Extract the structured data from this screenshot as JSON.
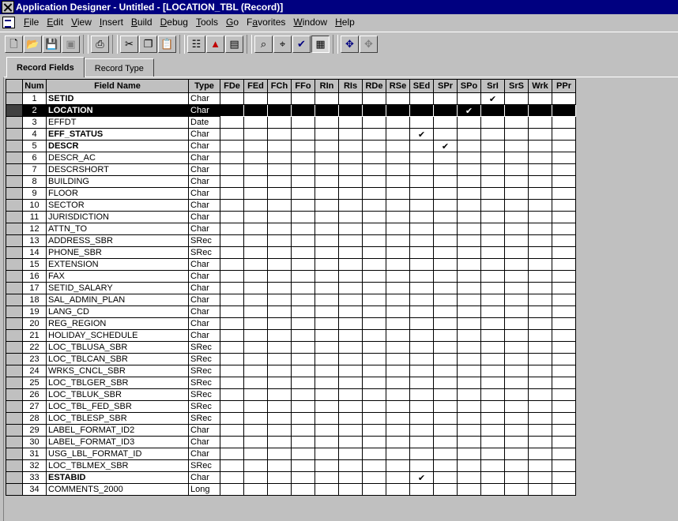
{
  "window": {
    "title": "Application Designer - Untitled - [LOCATION_TBL (Record)]"
  },
  "menu": [
    {
      "label": "File",
      "mnemonic": "F",
      "rest": "ile"
    },
    {
      "label": "Edit",
      "mnemonic": "E",
      "rest": "dit"
    },
    {
      "label": "View",
      "mnemonic": "V",
      "rest": "iew"
    },
    {
      "label": "Insert",
      "mnemonic": "I",
      "rest": "nsert"
    },
    {
      "label": "Build",
      "mnemonic": "B",
      "rest": "uild"
    },
    {
      "label": "Debug",
      "mnemonic": "D",
      "rest": "ebug"
    },
    {
      "label": "Tools",
      "mnemonic": "T",
      "rest": "ools"
    },
    {
      "label": "Go",
      "mnemonic": "G",
      "rest": "o"
    },
    {
      "label": "Favorites",
      "mnemonic": "a",
      "pre": "F",
      "rest": "vorites"
    },
    {
      "label": "Window",
      "mnemonic": "W",
      "rest": "indow"
    },
    {
      "label": "Help",
      "mnemonic": "H",
      "rest": "elp"
    }
  ],
  "toolbar": {
    "icons": [
      "new-icon",
      "open-icon",
      "save-icon",
      "save-all-icon",
      "print-icon",
      "cut-icon",
      "copy-icon",
      "paste-icon",
      "properties-icon",
      "build-icon",
      "project-icon",
      "find-definition-icon",
      "find-in-icon",
      "validate-icon",
      "edit-pane-icon",
      "maximize-icon",
      "restore-icon"
    ]
  },
  "tabs": [
    {
      "label": "Record Fields",
      "active": true
    },
    {
      "label": "Record Type",
      "active": false
    }
  ],
  "grid": {
    "columns": [
      "Num",
      "Field Name",
      "Type",
      "FDe",
      "FEd",
      "FCh",
      "FFo",
      "RIn",
      "RIs",
      "RDe",
      "RSe",
      "SEd",
      "SPr",
      "SPo",
      "SrI",
      "SrS",
      "Wrk",
      "PPr"
    ],
    "check_mark": "✔",
    "selected_row": 2,
    "rows": [
      {
        "num": "1",
        "name": "SETID",
        "type": "Char",
        "bold": true,
        "checks": [
          "SrI"
        ]
      },
      {
        "num": "2",
        "name": "LOCATION",
        "type": "Char",
        "bold": true,
        "checks": [
          "SPo"
        ]
      },
      {
        "num": "3",
        "name": "EFFDT",
        "type": "Date",
        "bold": false,
        "checks": []
      },
      {
        "num": "4",
        "name": "EFF_STATUS",
        "type": "Char",
        "bold": true,
        "checks": [
          "SEd"
        ]
      },
      {
        "num": "5",
        "name": "DESCR",
        "type": "Char",
        "bold": true,
        "checks": [
          "SPr"
        ]
      },
      {
        "num": "6",
        "name": "DESCR_AC",
        "type": "Char",
        "bold": false,
        "checks": []
      },
      {
        "num": "7",
        "name": "DESCRSHORT",
        "type": "Char",
        "bold": false,
        "checks": []
      },
      {
        "num": "8",
        "name": "BUILDING",
        "type": "Char",
        "bold": false,
        "checks": []
      },
      {
        "num": "9",
        "name": "FLOOR",
        "type": "Char",
        "bold": false,
        "checks": []
      },
      {
        "num": "10",
        "name": "SECTOR",
        "type": "Char",
        "bold": false,
        "checks": []
      },
      {
        "num": "11",
        "name": "JURISDICTION",
        "type": "Char",
        "bold": false,
        "checks": []
      },
      {
        "num": "12",
        "name": "ATTN_TO",
        "type": "Char",
        "bold": false,
        "checks": []
      },
      {
        "num": "13",
        "name": "ADDRESS_SBR",
        "type": "SRec",
        "bold": false,
        "checks": []
      },
      {
        "num": "14",
        "name": "PHONE_SBR",
        "type": "SRec",
        "bold": false,
        "checks": []
      },
      {
        "num": "15",
        "name": "EXTENSION",
        "type": "Char",
        "bold": false,
        "checks": []
      },
      {
        "num": "16",
        "name": "FAX",
        "type": "Char",
        "bold": false,
        "checks": []
      },
      {
        "num": "17",
        "name": "SETID_SALARY",
        "type": "Char",
        "bold": false,
        "checks": []
      },
      {
        "num": "18",
        "name": "SAL_ADMIN_PLAN",
        "type": "Char",
        "bold": false,
        "checks": []
      },
      {
        "num": "19",
        "name": "LANG_CD",
        "type": "Char",
        "bold": false,
        "checks": []
      },
      {
        "num": "20",
        "name": "REG_REGION",
        "type": "Char",
        "bold": false,
        "checks": []
      },
      {
        "num": "21",
        "name": "HOLIDAY_SCHEDULE",
        "type": "Char",
        "bold": false,
        "checks": []
      },
      {
        "num": "22",
        "name": "LOC_TBLUSA_SBR",
        "type": "SRec",
        "bold": false,
        "checks": []
      },
      {
        "num": "23",
        "name": "LOC_TBLCAN_SBR",
        "type": "SRec",
        "bold": false,
        "checks": []
      },
      {
        "num": "24",
        "name": "WRKS_CNCL_SBR",
        "type": "SRec",
        "bold": false,
        "checks": []
      },
      {
        "num": "25",
        "name": "LOC_TBLGER_SBR",
        "type": "SRec",
        "bold": false,
        "checks": []
      },
      {
        "num": "26",
        "name": "LOC_TBLUK_SBR",
        "type": "SRec",
        "bold": false,
        "checks": []
      },
      {
        "num": "27",
        "name": "LOC_TBL_FED_SBR",
        "type": "SRec",
        "bold": false,
        "checks": []
      },
      {
        "num": "28",
        "name": "LOC_TBLESP_SBR",
        "type": "SRec",
        "bold": false,
        "checks": []
      },
      {
        "num": "29",
        "name": "LABEL_FORMAT_ID2",
        "type": "Char",
        "bold": false,
        "checks": []
      },
      {
        "num": "30",
        "name": "LABEL_FORMAT_ID3",
        "type": "Char",
        "bold": false,
        "checks": []
      },
      {
        "num": "31",
        "name": "USG_LBL_FORMAT_ID",
        "type": "Char",
        "bold": false,
        "checks": []
      },
      {
        "num": "32",
        "name": "LOC_TBLMEX_SBR",
        "type": "SRec",
        "bold": false,
        "checks": []
      },
      {
        "num": "33",
        "name": "ESTABID",
        "type": "Char",
        "bold": true,
        "checks": [
          "SEd"
        ]
      },
      {
        "num": "34",
        "name": "COMMENTS_2000",
        "type": "Long",
        "bold": false,
        "checks": []
      }
    ]
  },
  "colors": {
    "title_bar": "#000080",
    "selected_row": "#000000",
    "chrome": "#c0c0c0"
  }
}
